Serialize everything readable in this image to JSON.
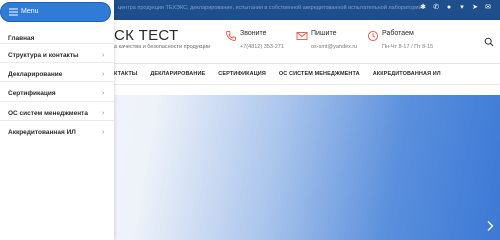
{
  "topbar": {
    "text": "центра продукции ТЕХЭКС, декларирование, испытания в собственной аккредитованной испытательной лаборатории",
    "social": [
      "bluetooth-icon",
      "vk-icon",
      "whatsapp-icon",
      "vk-icon",
      "telegram-icon",
      "mail-icon"
    ]
  },
  "header": {
    "logo": "СК ТЕСТ",
    "tagline": "а качества и безопасности продукции",
    "phone": {
      "title": "Звоните",
      "value": "+7(4812) 353-271"
    },
    "mail": {
      "title": "Пишите",
      "value": "os-smt@yandex.ru"
    },
    "work": {
      "title": "Работаем",
      "value": "Пн-Чт 8-17 / Пт 8-15"
    }
  },
  "nav": {
    "items": [
      "КТАКТЫ",
      "ДЕКЛАРИРОВАНИЕ",
      "СЕРТИФИКАЦИЯ",
      "ОС СИСТЕМ МЕНЕДЖМЕНТА",
      "АККРЕДИТОВАННАЯ ИЛ"
    ]
  },
  "menu": {
    "button_label": "Menu",
    "items": [
      {
        "label": "Главная",
        "has_children": false
      },
      {
        "label": "Структура и контакты",
        "has_children": true
      },
      {
        "label": "Декларирование",
        "has_children": true
      },
      {
        "label": "Сертификация",
        "has_children": true
      },
      {
        "label": "ОС систем менеджмента",
        "has_children": true
      },
      {
        "label": "Аккредитованная ИЛ",
        "has_children": true
      }
    ]
  },
  "colors": {
    "accent": "#2f7bd6",
    "topbar": "#1e4f8c",
    "icon": "#e0584f"
  }
}
